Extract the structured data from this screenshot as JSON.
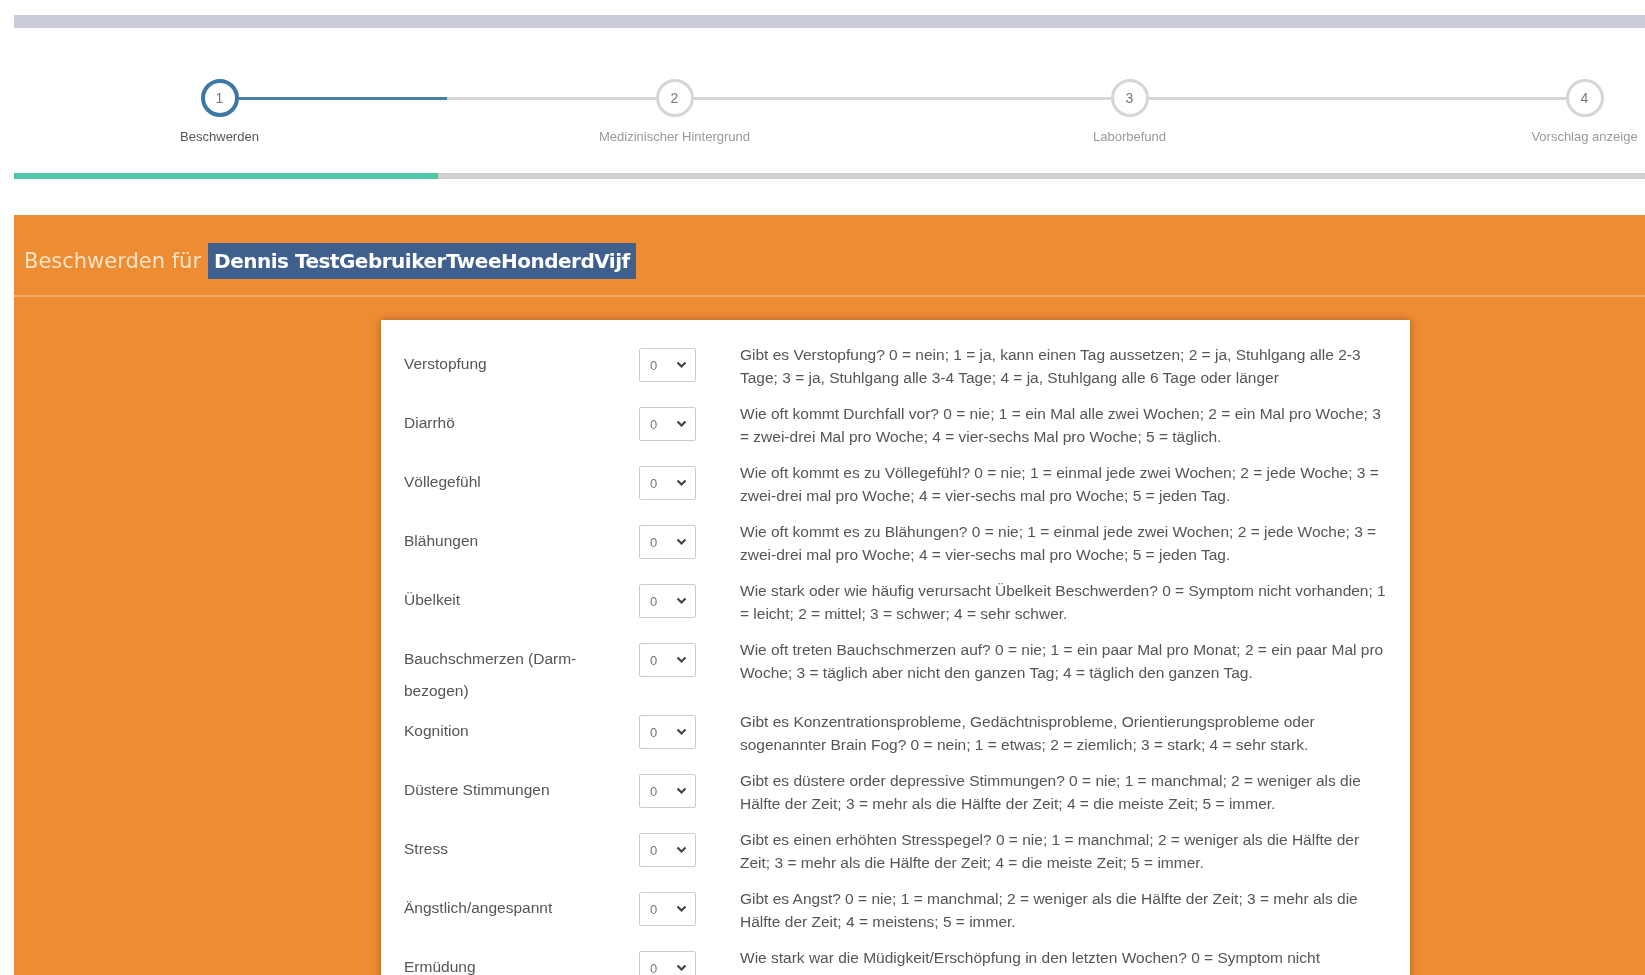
{
  "steps": [
    {
      "number": "1",
      "label": "Beschwerden",
      "selected": true
    },
    {
      "number": "2",
      "label": "Medizinischer Hintergrund",
      "selected": false
    },
    {
      "number": "3",
      "label": "Laborbefund",
      "selected": false
    },
    {
      "number": "4",
      "label": "Vorschlag anzeige",
      "selected": false
    }
  ],
  "progress": {
    "level": 0.26
  },
  "header": {
    "prefix": "Beschwerden für",
    "patient": "Dennis TestGebruikerTweeHonderdVijf"
  },
  "symptoms": [
    {
      "label": "Verstopfung",
      "value": "0",
      "description": "Gibt es Verstopfung? 0 = nein; 1 = ja, kann einen Tag aussetzen; 2 = ja, Stuhlgang alle 2-3 Tage; 3 = ja, Stuhlgang alle 3-4 Tage; 4 = ja, Stuhlgang alle 6 Tage oder länger"
    },
    {
      "label": "Diarrhö",
      "value": "0",
      "description": "Wie oft kommt Durchfall vor? 0 = nie; 1 = ein Mal alle zwei Wochen; 2 = ein Mal pro Woche; 3 = zwei-drei Mal pro Woche; 4 = vier-sechs Mal pro Woche; 5 = täglich."
    },
    {
      "label": "Völlegefühl",
      "value": "0",
      "description": "Wie oft kommt es zu Völlegefühl? 0 = nie; 1 = einmal jede zwei Wochen; 2 = jede Woche; 3 = zwei-drei mal pro Woche; 4 = vier-sechs mal pro Woche; 5 = jeden Tag."
    },
    {
      "label": "Blähungen",
      "value": "0",
      "description": "Wie oft kommt es zu Blähungen? 0 = nie; 1 = einmal jede zwei Wochen; 2 = jede Woche; 3 = zwei-drei mal pro Woche; 4 = vier-sechs mal pro Woche; 5 = jeden Tag."
    },
    {
      "label": "Übelkeit",
      "value": "0",
      "description": "Wie stark oder wie häufig verursacht Übelkeit Beschwerden? 0 = Symptom nicht vorhanden; 1 = leicht; 2 = mittel; 3 = schwer; 4 = sehr schwer."
    },
    {
      "label": "Bauchschmerzen (Darm-bezogen)",
      "value": "0",
      "description": "Wie oft treten Bauchschmerzen auf? 0 = nie; 1 = ein paar Mal pro Monat; 2 = ein paar Mal pro Woche; 3 = täglich aber nicht den ganzen Tag; 4 = täglich den ganzen Tag."
    },
    {
      "label": "Kognition",
      "value": "0",
      "description": "Gibt es Konzentrationsprobleme, Gedächtnisprobleme, Orientierungsprobleme oder sogenannter Brain Fog? 0 = nein; 1 = etwas; 2 = ziemlich; 3 = stark; 4 = sehr stark."
    },
    {
      "label": "Düstere Stimmungen",
      "value": "0",
      "description": "Gibt es düstere order depressive Stimmungen? 0 = nie; 1 = manchmal; 2 = weniger als die Hälfte der Zeit; 3 = mehr als die Hälfte der Zeit; 4 = die meiste Zeit; 5 = immer."
    },
    {
      "label": "Stress",
      "value": "0",
      "description": "Gibt es einen erhöhten Stresspegel? 0 = nie; 1 = manchmal; 2 = weniger als die Hälfte der Zeit; 3 = mehr als die Hälfte der Zeit; 4 = die meiste Zeit; 5 = immer."
    },
    {
      "label": "Ängstlich/angespannt",
      "value": "0",
      "description": "Gibt es Angst? 0 = nie; 1 = manchmal; 2 = weniger als die Hälfte der Zeit; 3 = mehr als die Hälfte der Zeit; 4 = meistens; 5 = immer."
    },
    {
      "label": "Ermüdung",
      "value": "0",
      "description": "Wie stark war die Müdigkeit/Erschöpfung in den letzten Wochen? 0 = Symptom nicht"
    }
  ]
}
